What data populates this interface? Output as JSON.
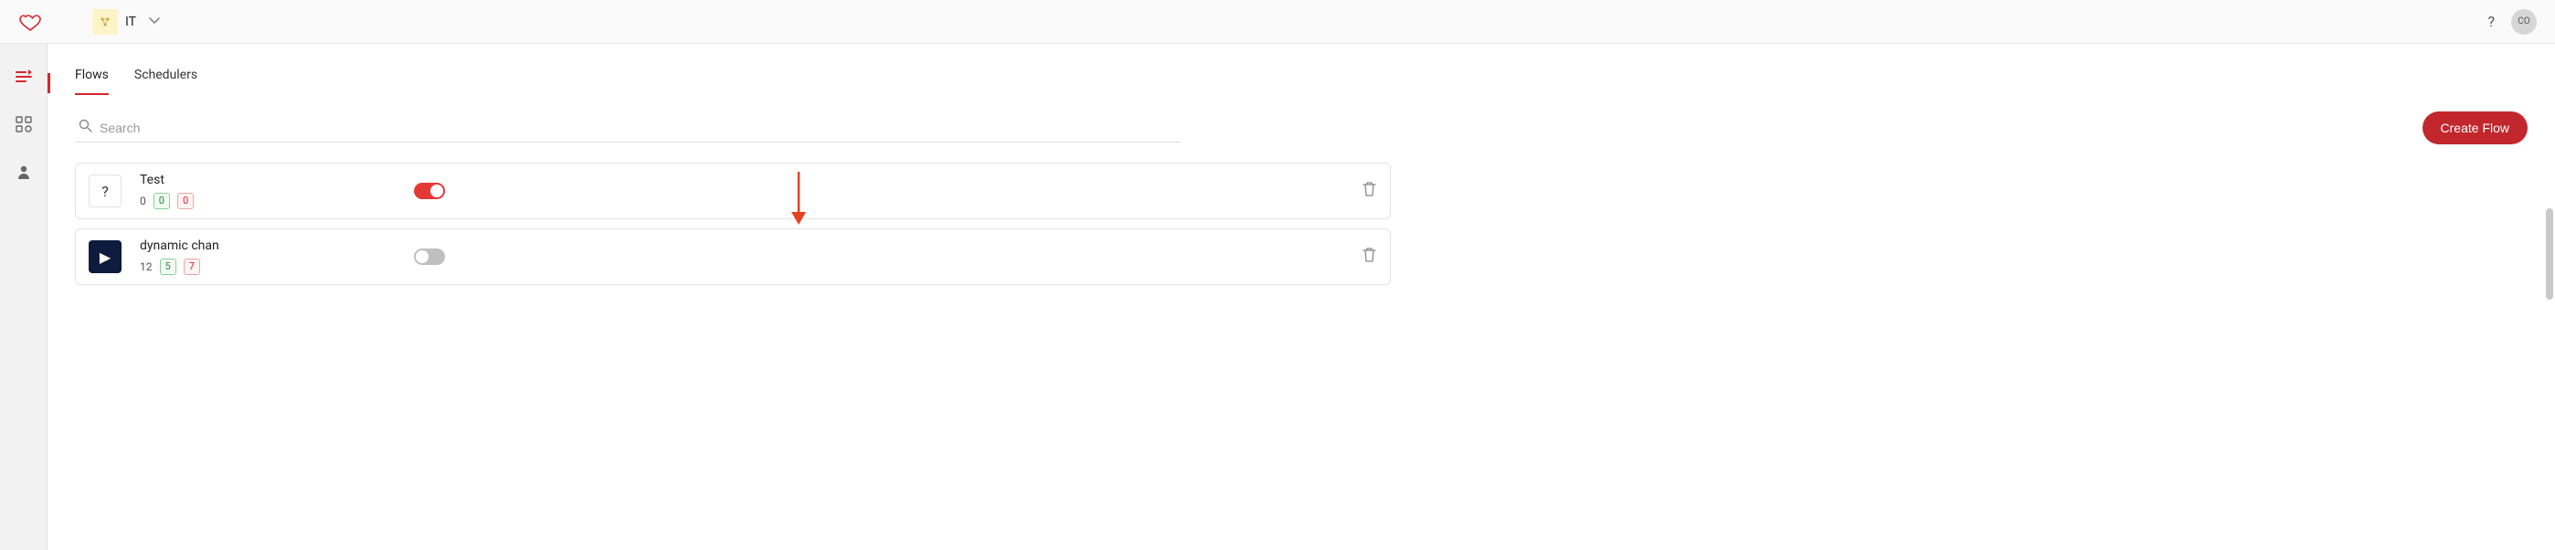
{
  "topbar": {
    "workspace_label": "IT",
    "help_glyph": "?",
    "avatar_initials": "CO"
  },
  "tabs": [
    {
      "label": "Flows",
      "active": true
    },
    {
      "label": "Schedulers",
      "active": false
    }
  ],
  "search": {
    "placeholder": "Search"
  },
  "actions": {
    "create_label": "Create Flow"
  },
  "flows": [
    {
      "name": "Test",
      "icon_glyph": "?",
      "icon_style": "light",
      "count_plain": "0",
      "count_green": "0",
      "count_red": "0",
      "enabled": true
    },
    {
      "name": "dynamic chan",
      "icon_glyph": "▶",
      "icon_style": "dark",
      "count_plain": "12",
      "count_green": "5",
      "count_red": "7",
      "enabled": false
    }
  ]
}
